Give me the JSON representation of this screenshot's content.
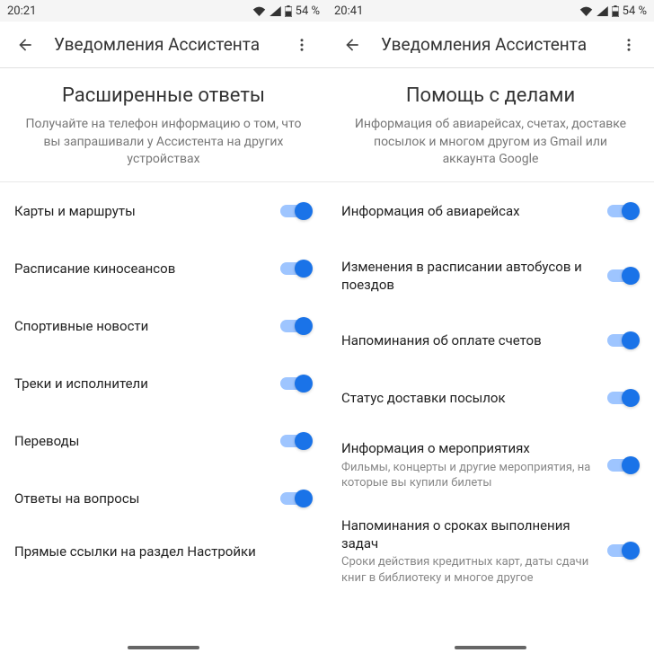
{
  "left": {
    "status": {
      "time": "20:21",
      "battery_pct": "54 %"
    },
    "appbar": {
      "title": "Уведомления Ассистента"
    },
    "section": {
      "title": "Расширенные ответы",
      "subtitle": "Получайте на телефон информацию о том, что вы запрашивали у Ассистента на других устройствах"
    },
    "items": [
      {
        "label": "Карты и маршруты"
      },
      {
        "label": "Расписание киносеансов"
      },
      {
        "label": "Спортивные новости"
      },
      {
        "label": "Треки и исполнители"
      },
      {
        "label": "Переводы"
      },
      {
        "label": "Ответы на вопросы"
      }
    ],
    "partial": "Прямые ссылки на раздел Настройки"
  },
  "right": {
    "status": {
      "time": "20:41",
      "battery_pct": "54 %"
    },
    "appbar": {
      "title": "Уведомления Ассистента"
    },
    "section": {
      "title": "Помощь с делами",
      "subtitle": "Информация об авиарейсах, счетах, доставке посылок и многом другом из Gmail или аккаунта Google"
    },
    "items": [
      {
        "label": "Информация об авиарейсах"
      },
      {
        "label": "Изменения в расписании автобусов и поездов"
      },
      {
        "label": "Напоминания об оплате счетов"
      },
      {
        "label": "Статус доставки посылок"
      },
      {
        "label": "Информация о мероприятиях",
        "desc": "Фильмы, концерты и другие мероприятия, на которые вы купили билеты"
      },
      {
        "label": "Напоминания о сроках выполнения задач",
        "desc": "Сроки действия кредитных карт, даты сдачи книг в библиотеку и многое другое"
      }
    ]
  }
}
